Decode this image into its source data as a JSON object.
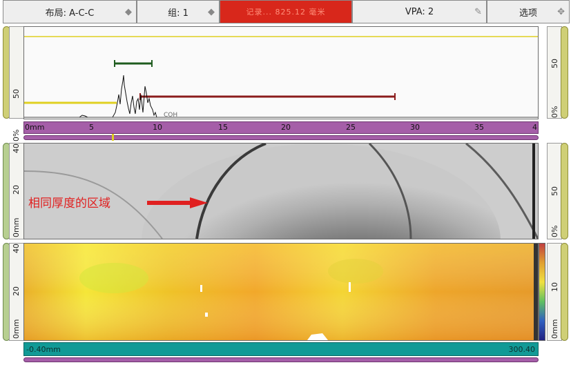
{
  "toolbar": {
    "layout_label": "布局: A-C-C",
    "group_label": "组: 1",
    "status_text": "记录... 825.12 毫米",
    "vpa_label": "VPA: 2",
    "options_label": "选项"
  },
  "ascan": {
    "left_scale_labels": [
      "50",
      "0%"
    ],
    "right_scale_labels": [
      "50",
      "0%"
    ],
    "ruler_unit_label": "0mm",
    "ruler_ticks": [
      "5",
      "10",
      "15",
      "20",
      "25",
      "30",
      "35",
      "4"
    ],
    "cursor_label": "COH"
  },
  "bscan": {
    "left_scale_labels": [
      "40",
      "20",
      "0mm"
    ],
    "right_scale_labels": [
      "50",
      "0%"
    ],
    "annotation": "相同厚度的区域"
  },
  "cscan": {
    "left_scale_labels": [
      "40",
      "20",
      "0mm"
    ],
    "right_scale_labels": [
      "10",
      "0mm"
    ],
    "start_label": "-0.40mm",
    "end_label": "300.40"
  },
  "colors": {
    "toolbar_status": "#d8271b",
    "ruler": "#a55ea8",
    "rail_yellow": "#cfcf76",
    "rail_green": "#b7cf90",
    "gate_a": "#1f5c1f",
    "gate_b": "#8b1c1c",
    "gate_i": "#e0d021",
    "arrow": "#e02020",
    "bottom_bar": "#119a96"
  }
}
